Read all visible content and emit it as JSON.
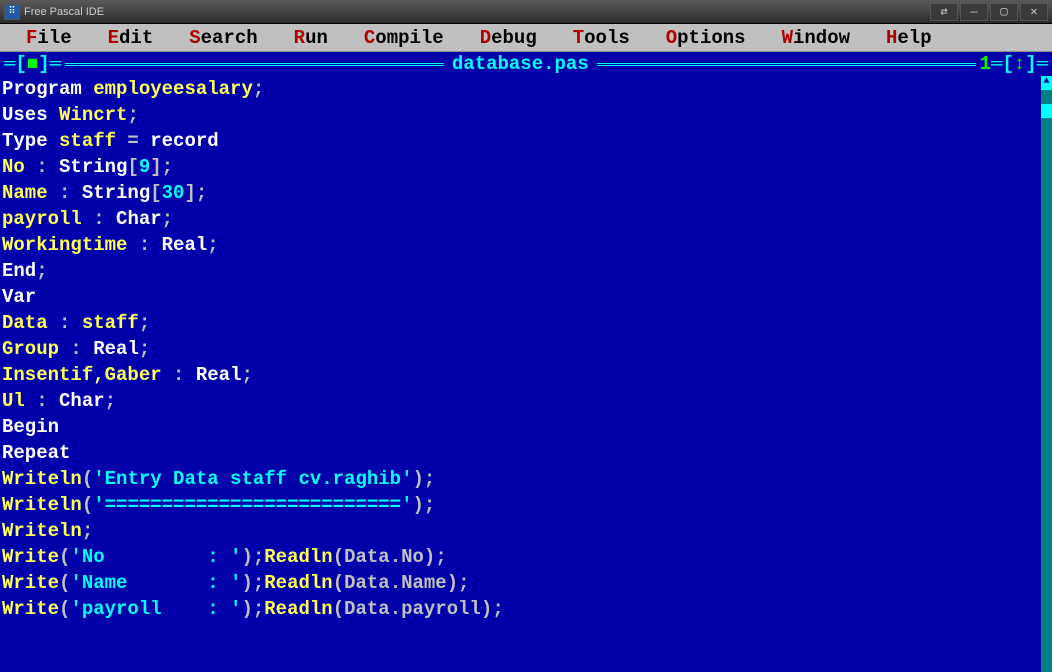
{
  "titlebar": {
    "app_title": "Free Pascal IDE"
  },
  "window_controls": {
    "swap": "⇄",
    "min": "—",
    "max": "▢",
    "close": "✕"
  },
  "menubar": [
    {
      "hot": "F",
      "rest": "ile"
    },
    {
      "hot": "E",
      "rest": "dit"
    },
    {
      "hot": "S",
      "rest": "earch"
    },
    {
      "hot": "R",
      "rest": "un"
    },
    {
      "hot": "C",
      "rest": "ompile"
    },
    {
      "hot": "D",
      "rest": "ebug"
    },
    {
      "hot": "T",
      "rest": "ools"
    },
    {
      "hot": "O",
      "rest": "ptions"
    },
    {
      "hot": "W",
      "rest": "indow"
    },
    {
      "hot": "H",
      "rest": "elp"
    }
  ],
  "frame": {
    "left_marker": "═[",
    "left_square": "■",
    "left_marker_end": "]═",
    "title": "database.pas",
    "right_num": "1",
    "right_eq": "═",
    "right_arr_open": "[",
    "right_arr": "↕",
    "right_arr_close": "]═"
  },
  "code": {
    "l1_kw": "Program",
    "l1_id": "employeesalary",
    "l1_sym": ";",
    "l2_kw": "Uses",
    "l2_id": "Wincrt",
    "l2_sym": ";",
    "l3_kw": "Type",
    "l3_id": "staff",
    "l3_eq": " = ",
    "l3_kw2": "record",
    "l4_id": "No",
    "l4_mid": " : ",
    "l4_kw": "String",
    "l4_o": "[",
    "l4_num": "9",
    "l4_c": "];",
    "l5_id": "Name",
    "l5_mid": " : ",
    "l5_kw": "String",
    "l5_o": "[",
    "l5_num": "30",
    "l5_c": "];",
    "l6_id": "payroll",
    "l6_mid": " : ",
    "l6_kw": "Char",
    "l6_sym": ";",
    "l7_id": "Workingtime",
    "l7_mid": " : ",
    "l7_kw": "Real",
    "l7_sym": ";",
    "l8_kw": "End",
    "l8_sym": ";",
    "l9_kw": "Var",
    "l10_id": "Data",
    "l10_mid": " : ",
    "l10_id2": "staff",
    "l10_sym": ";",
    "l11_id": "Group",
    "l11_mid": " : ",
    "l11_kw": "Real",
    "l11_sym": ";",
    "l12_id": "Insentif,Gaber",
    "l12_mid": " : ",
    "l12_kw": "Real",
    "l12_sym": ";",
    "l13_id": "Ul",
    "l13_mid": " : ",
    "l13_kw": "Char",
    "l13_sym": ";",
    "l14_kw": "Begin",
    "l15_kw": "Repeat",
    "l16_id": "Writeln",
    "l16_o": "(",
    "l16_str": "'Entry Data staff cv.raghib'",
    "l16_c": ");",
    "l17_id": "Writeln",
    "l17_o": "(",
    "l17_str": "'=========================='",
    "l17_c": ");",
    "l18_id": "Writeln",
    "l18_sym": ";",
    "l19_id": "Write",
    "l19_o": "(",
    "l19_str": "'No         : '",
    "l19_c": ");",
    "l19_id2": "Readln",
    "l19_o2": "(",
    "l19_arg": "Data.No",
    "l19_c2": ");",
    "l20_id": "Write",
    "l20_o": "(",
    "l20_str": "'Name       : '",
    "l20_c": ");",
    "l20_id2": "Readln",
    "l20_o2": "(",
    "l20_arg": "Data.Name",
    "l20_c2": ");",
    "l21_id": "Write",
    "l21_o": "(",
    "l21_str": "'payroll    : '",
    "l21_c": ");",
    "l21_id2": "Readln",
    "l21_o2": "(",
    "l21_arg": "Data.payroll",
    "l21_c2": ");"
  }
}
